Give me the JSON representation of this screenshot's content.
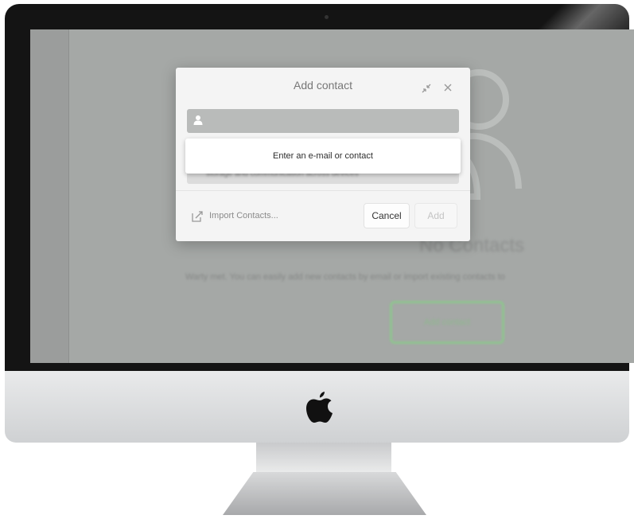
{
  "device": {
    "logo_icon": "apple-logo-icon"
  },
  "background_app": {
    "empty_title": "No Contacts",
    "empty_text": "Warty met. You can easily add new contacts by email or import existing contacts to",
    "add_contact_button": "Add contact",
    "contacts_icon": "contacts-silhouette-icon"
  },
  "dialog": {
    "title": "Add contact",
    "resize_icon": "collapse-arrows-icon",
    "close_icon": "close-icon",
    "input": {
      "icon": "person-icon",
      "value": "",
      "placeholder": ""
    },
    "suggestion": "Enter an e-mail or contact",
    "suggestion_underlay_text": "storage and communication across devices",
    "footer": {
      "import_label": "Import Contacts...",
      "import_icon": "import-icon",
      "cancel_label": "Cancel",
      "add_label": "Add"
    }
  },
  "colors": {
    "accent_green": "#8fc48f",
    "dialog_bg": "#f4f4f4",
    "bezel": "#141414"
  }
}
